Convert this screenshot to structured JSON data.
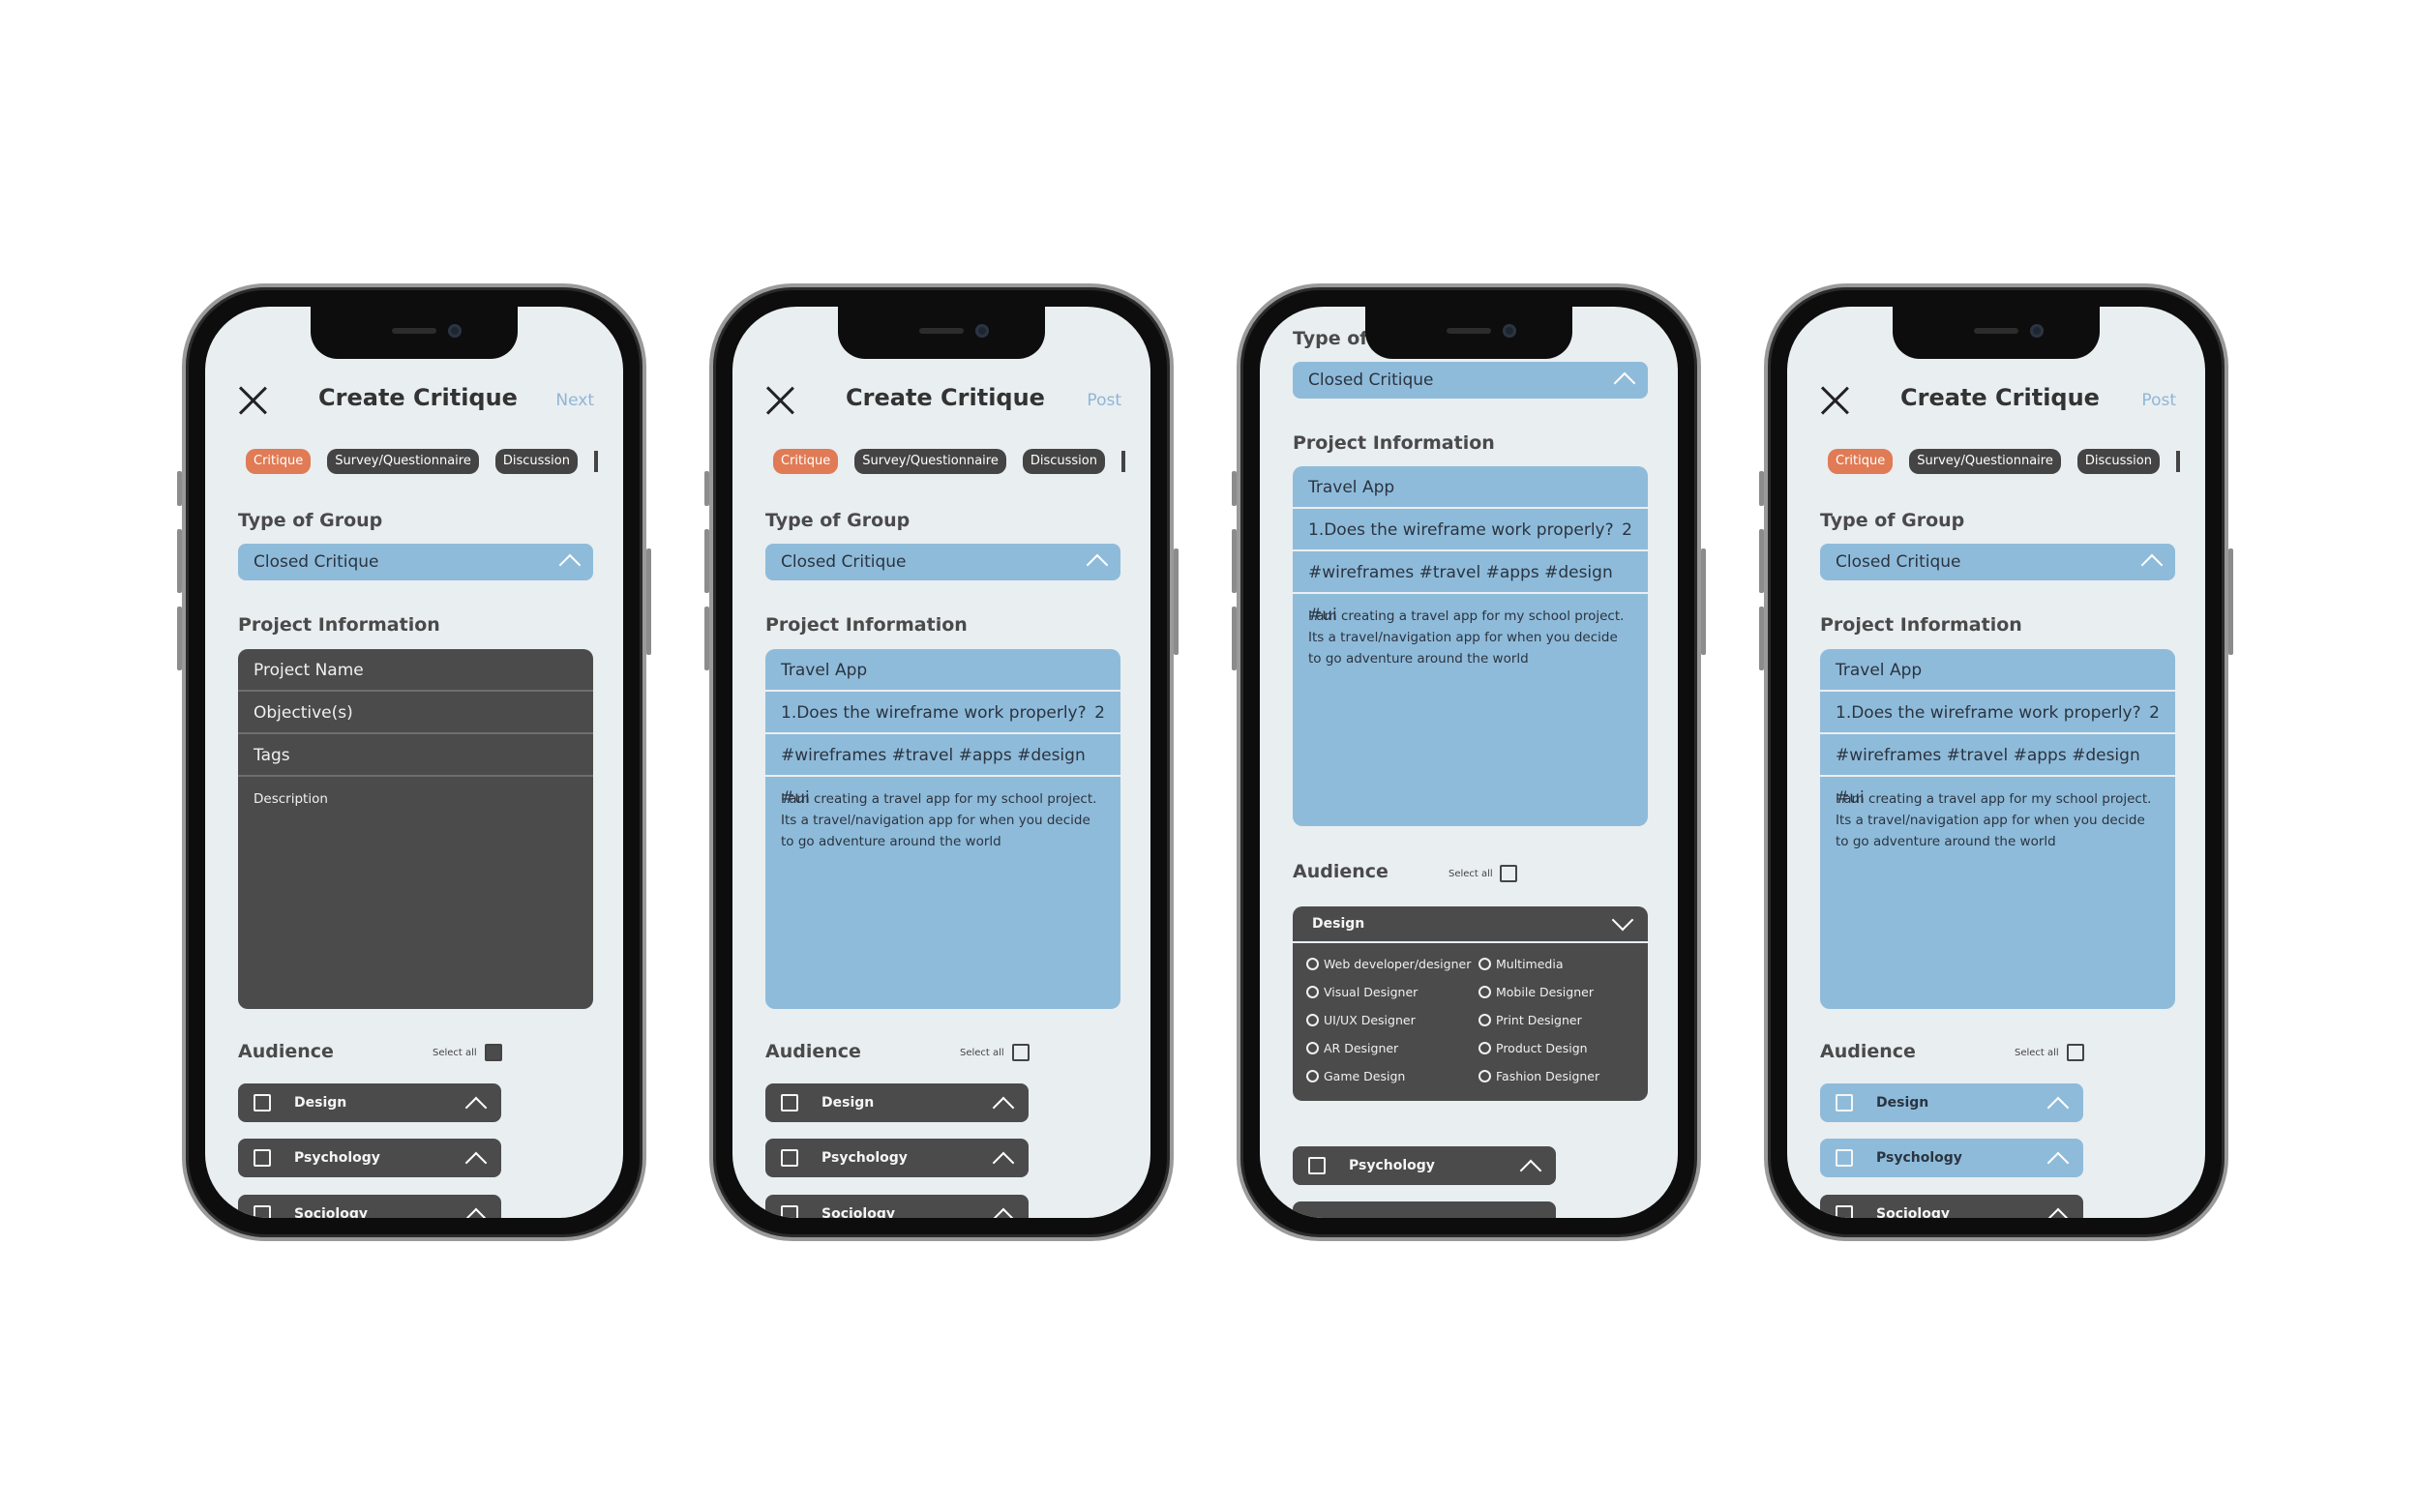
{
  "screens": [
    {
      "header": {
        "close": "close",
        "title": "Create Critique",
        "action": "Next"
      },
      "tabs": [
        "Critique",
        "Survey/Questionnaire",
        "Discussion"
      ],
      "group": {
        "label": "Type of Group",
        "value": "Closed Critique"
      },
      "project": {
        "label": "Project Information",
        "name": "Project Name",
        "objective": "Objective(s)",
        "objective_count": "",
        "tags": "Tags",
        "description": "Description"
      },
      "audience": {
        "label": "Audience",
        "select_all": "Select all",
        "items": [
          "Design",
          "Psychology",
          "Sociology"
        ]
      }
    },
    {
      "header": {
        "close": "close",
        "title": "Create Critique",
        "action": "Post"
      },
      "tabs": [
        "Critique",
        "Survey/Questionnaire",
        "Discussion"
      ],
      "group": {
        "label": "Type of Group",
        "value": "Closed Critique"
      },
      "project": {
        "label": "Project Information",
        "name": "Travel App",
        "objective": "1.Does the wireframe work properly?",
        "objective_count": "2",
        "tags": "#wireframes #travel #apps #design #ui",
        "description": "I am creating a travel app for my school project. Its a travel/navigation app for when you decide to go adventure around the world"
      },
      "audience": {
        "label": "Audience",
        "select_all": "Select all",
        "items": [
          "Design",
          "Psychology",
          "Sociology"
        ]
      }
    },
    {
      "group": {
        "label": "Type of Group",
        "value": "Closed Critique"
      },
      "project": {
        "label": "Project Information",
        "name": "Travel App",
        "objective": "1.Does the wireframe work properly?",
        "objective_count": "2",
        "tags": "#wireframes #travel #apps #design #ui",
        "description": "I am creating a travel app for my school project. Its a travel/navigation app for when you decide to go adventure around the world"
      },
      "audience": {
        "label": "Audience",
        "select_all": "Select all",
        "dropdown": {
          "title": "Design",
          "options": [
            "Web developer/designer",
            "Multimedia",
            "Visual Designer",
            "Mobile Designer",
            "UI/UX Designer",
            "Print Designer",
            "AR Designer",
            "Product Design",
            "Game Design",
            "Fashion Designer"
          ]
        },
        "items": [
          "Psychology"
        ]
      }
    },
    {
      "header": {
        "close": "close",
        "title": "Create Critique",
        "action": "Post"
      },
      "tabs": [
        "Critique",
        "Survey/Questionnaire",
        "Discussion"
      ],
      "group": {
        "label": "Type of Group",
        "value": "Closed Critique"
      },
      "project": {
        "label": "Project Information",
        "name": "Travel App",
        "objective": "1.Does the wireframe work properly?",
        "objective_count": "2",
        "tags": "#wireframes #travel #apps #design #ui",
        "description": "I am creating a travel app for my school project. Its a travel/navigation app for when you decide to go adventure around the world"
      },
      "audience": {
        "label": "Audience",
        "select_all": "Select all",
        "items": [
          "Design",
          "Psychology",
          "Sociology"
        ]
      }
    }
  ],
  "colors": {
    "accent": "#e07b55",
    "blue": "#8fbbda",
    "dark": "#4b4b4b",
    "screen_bg": "#e9eef1",
    "link": "#8fb6d6"
  }
}
